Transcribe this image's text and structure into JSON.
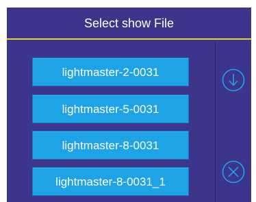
{
  "dialog": {
    "title": "Select show File",
    "files": [
      "lightmaster-2-0031",
      "lightmaster-5-0031",
      "lightmaster-8-0031",
      "lightmaster-8-0031_1"
    ],
    "scroll_down_icon": "circle-arrow-down-icon",
    "cancel_icon": "circle-x-icon"
  },
  "colors": {
    "panel": "#3d348c",
    "title_divider": "#e6d23a",
    "button": "#1ea3e6",
    "icon": "#1ea3e6"
  }
}
